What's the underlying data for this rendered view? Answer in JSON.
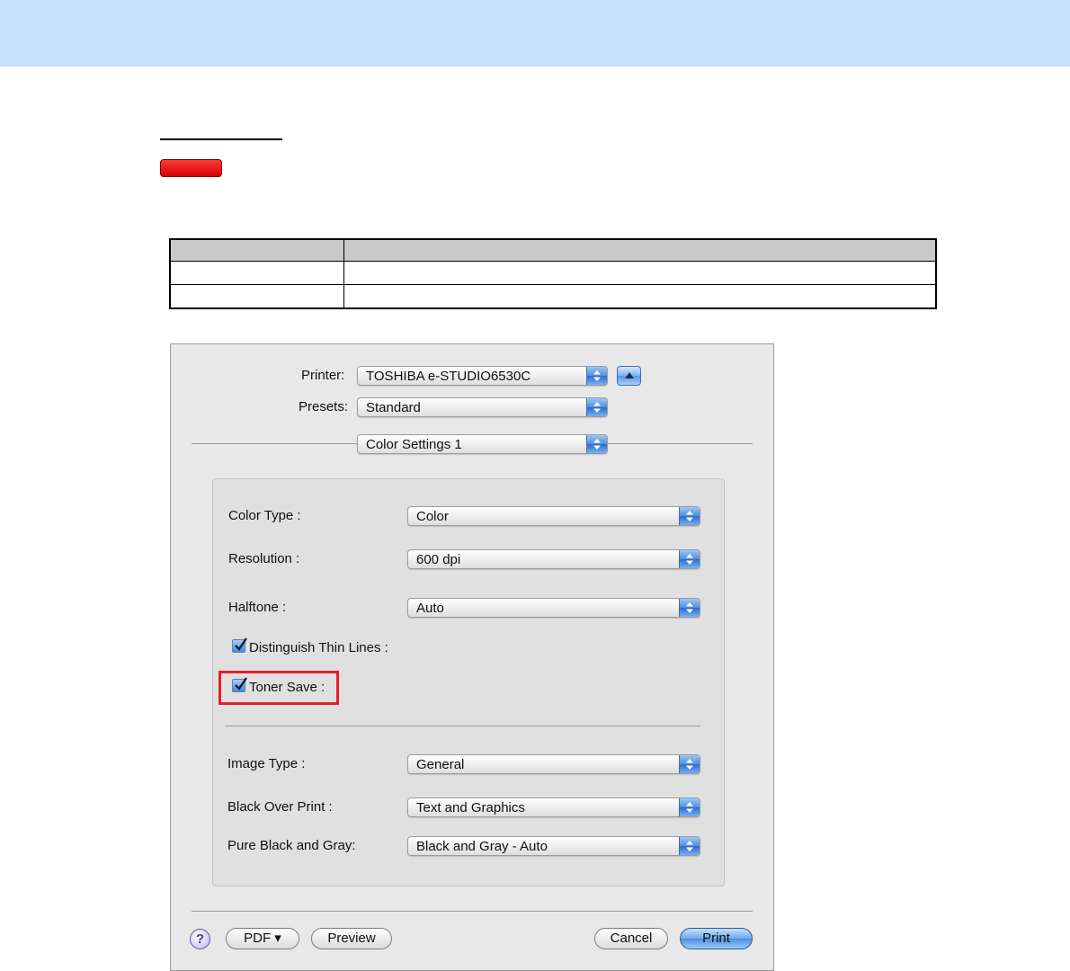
{
  "dialog": {
    "printer_label": "Printer:",
    "printer_value": "TOSHIBA e-STUDIO6530C",
    "presets_label": "Presets:",
    "presets_value": "Standard",
    "panel_value": "Color Settings 1",
    "settings": {
      "color_type_label": "Color Type :",
      "color_type_value": "Color",
      "resolution_label": "Resolution :",
      "resolution_value": "600 dpi",
      "halftone_label": "Halftone :",
      "halftone_value": "Auto",
      "thin_lines_label": "Distinguish Thin Lines :",
      "thin_lines_checked": true,
      "toner_save_label": "Toner Save :",
      "toner_save_checked": true,
      "image_type_label": "Image Type :",
      "image_type_value": "General",
      "black_over_print_label": "Black Over Print :",
      "black_over_print_value": "Text and Graphics",
      "pure_black_label": "Pure Black and Gray:",
      "pure_black_value": "Black and Gray - Auto"
    },
    "footer": {
      "help": "?",
      "pdf": "PDF ▾",
      "preview": "Preview",
      "cancel": "Cancel",
      "print": "Print"
    }
  },
  "colors": {
    "top_band": "#c5e2fb",
    "highlight": "#e3202b",
    "red_tag": "#e00000"
  }
}
